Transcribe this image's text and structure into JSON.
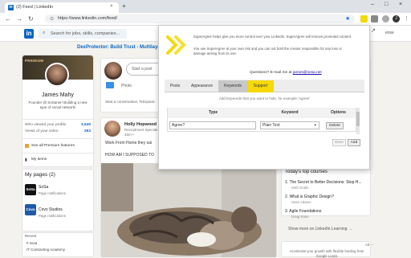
{
  "browser": {
    "tab_title": "(2) Feed | LinkedIn",
    "url": "https://www.linkedin.com/feed/",
    "new_tab": "+",
    "favicon_letter": "in"
  },
  "linkedin": {
    "logo": "in",
    "search_placeholder": "Search for jobs, skills, companies...",
    "promo": "DexProtector: Build Trust - Multilaye",
    "right_text": "ense",
    "profile": {
      "badge": "PREMIUM",
      "name": "James Mahy",
      "headline": "Founder @ SoSaner! Building a new type of social network!",
      "stats": [
        {
          "label": "Who viewed your profile",
          "value": "3,540"
        },
        {
          "label": "Views of your video",
          "value": "263"
        }
      ],
      "premium_link": "See all Premium features",
      "my_items": "My items"
    },
    "pages": {
      "title": "My pages (2)",
      "items": [
        {
          "logo": "SoSa",
          "name": "SoSa",
          "sub": "Page notifications",
          "color": "#111111"
        },
        {
          "logo": "Covo",
          "name": "Covo Studios",
          "sub": "Page notifications",
          "color": "#1e5aa8"
        }
      ]
    },
    "recent": {
      "title": "Recent",
      "items": [
        "# sosa",
        "IT Contracting Academy"
      ]
    },
    "start_post": {
      "placeholder": "Start a post",
      "photo": "Photo",
      "conversation": "Start a conversation: #Hispanic"
    },
    "post": {
      "author": "Holly Hopwood",
      "headline": "Recruitment Speciali...",
      "time": "45m •",
      "text1": "Work From Home they sai",
      "text2": "HOW AM I SUPPOSED TO"
    },
    "courses": {
      "title": "Today's top courses",
      "items": [
        {
          "n": "1.",
          "name": "The Secret to Better Decisions: Stop H...",
          "author": "Seth Godin"
        },
        {
          "n": "2.",
          "name": "What is Graphic Design?",
          "author": "Sean Adams"
        },
        {
          "n": "3.",
          "name": "Agile Foundations",
          "author": "Doug Rose"
        }
      ],
      "show_more": "Show more on LinkedIn Learning →"
    },
    "ad": {
      "label": "Ad ···",
      "text": "Accelerate your growth with flexible funding from Google Loans"
    }
  },
  "popup": {
    "para1": "SuperAgree helps give you more control over your LinkedIn. SuperAgree will remove promoted content.",
    "para2": "You use SuperAgree at your own risk and you can not hold the creator responsible for any loss or damage arising from its use.",
    "question": "Questions? E-mail me at ",
    "email": "james@sosa.net",
    "tabs": [
      "Posts",
      "Appearance",
      "Keywords",
      "Support"
    ],
    "description": "Add keywords that you want to hide, for example 'Agree!'",
    "columns": [
      "Type",
      "Keyword",
      "Options"
    ],
    "row": {
      "type": "Agree?",
      "keyword": "Plain Text",
      "option": "Delete"
    },
    "save": "Save",
    "add": "Add"
  },
  "icons": {
    "back": "←",
    "forward": "→",
    "reload": "↻",
    "lock": "🔒",
    "star": "★",
    "search": "🔍"
  }
}
